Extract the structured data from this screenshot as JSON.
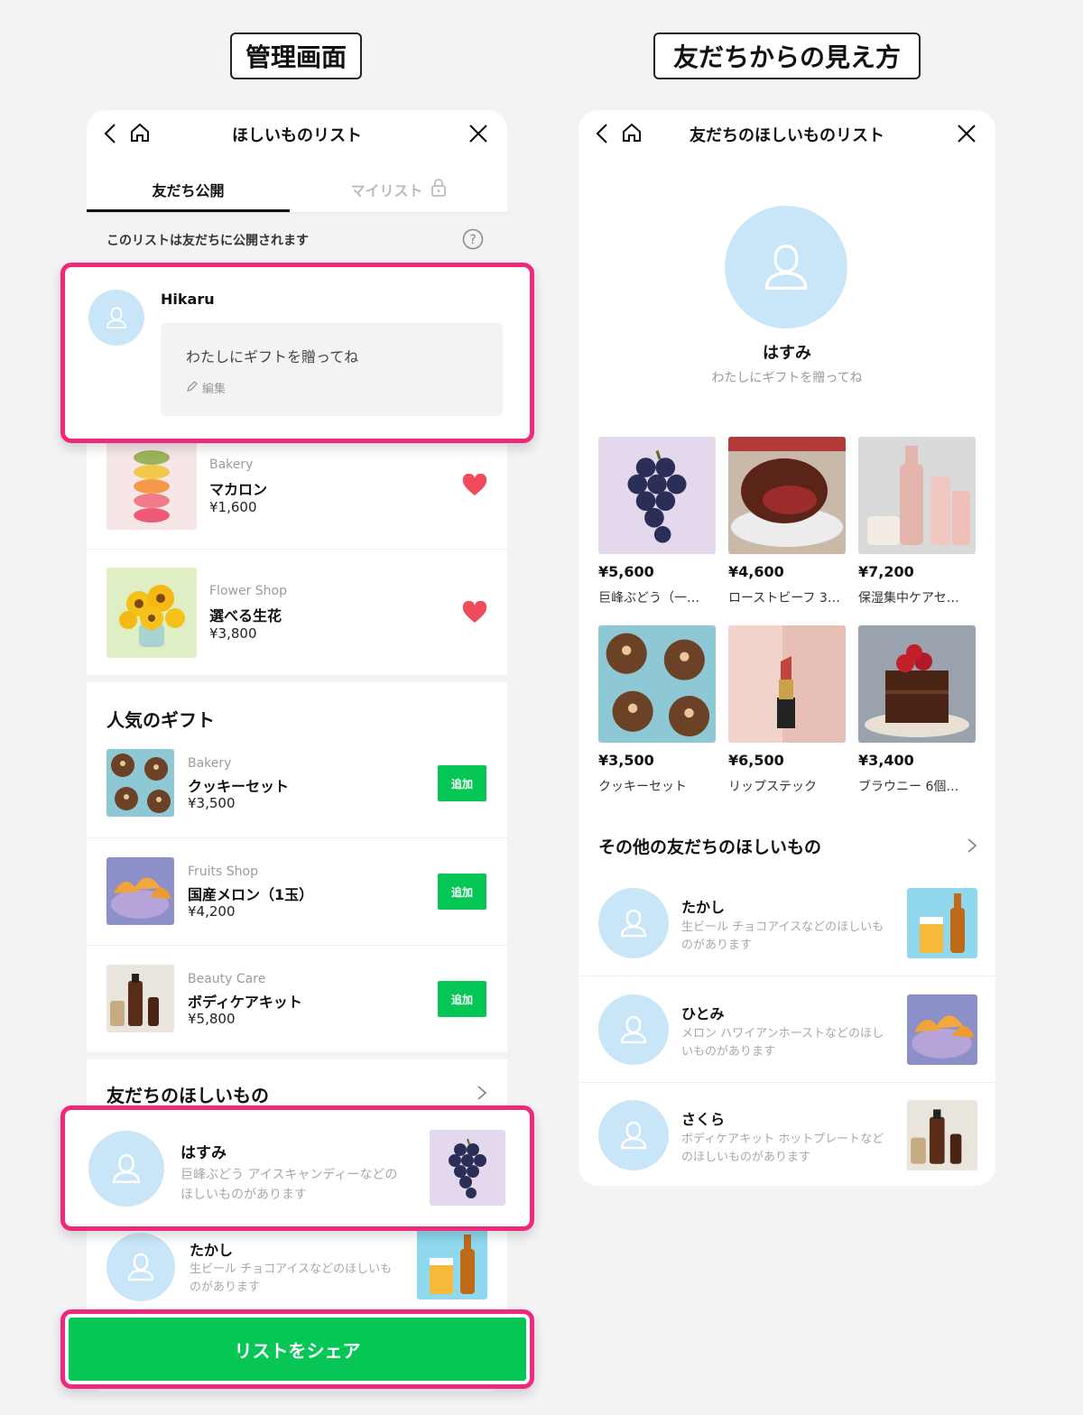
{
  "labels": {
    "admin": "管理画面",
    "friend_view": "友だちからの見え方"
  },
  "admin": {
    "title": "ほしいものリスト",
    "tabs": [
      {
        "label": "友だち公開",
        "active": true
      },
      {
        "label": "マイリスト",
        "active": false
      }
    ],
    "notice": "このリストは友だちに公開されます",
    "profile": {
      "name": "Hikaru",
      "message": "わたしにギフトを贈ってね",
      "edit_label": "編集"
    },
    "wishlist": [
      {
        "category": "Bakery",
        "name": "マカロン",
        "price": "¥1,600"
      },
      {
        "category": "Flower Shop",
        "name": "選べる生花",
        "price": "¥3,800"
      }
    ],
    "popular_title": "人気のギフト",
    "popular": [
      {
        "category": "Bakery",
        "name": "クッキーセット",
        "price": "¥3,500",
        "button": "追加"
      },
      {
        "category": "Fruits Shop",
        "name": "国産メロン（1玉）",
        "price": "¥4,200",
        "button": "追加"
      },
      {
        "category": "Beauty Care",
        "name": "ボディケアキット",
        "price": "¥5,800",
        "button": "追加"
      }
    ],
    "friends_title": "友だちのほしいもの",
    "friends": [
      {
        "name": "はすみ",
        "message_line1": "巨峰ぶどう アイスキャンディーなどの",
        "message_line2": "ほしいものがあります"
      },
      {
        "name": "たかし",
        "message_line1": "生ビール チョコアイスなどのほしいも",
        "message_line2": "のがあります"
      }
    ],
    "share_button": "リストをシェア"
  },
  "friend_view": {
    "title": "友だちのほしいものリスト",
    "profile": {
      "name": "はすみ",
      "message": "わたしにギフトを贈ってね"
    },
    "items": [
      {
        "price": "¥5,600",
        "name": "巨峰ぶどう（一…"
      },
      {
        "price": "¥4,600",
        "name": "ローストビーフ 3…"
      },
      {
        "price": "¥7,200",
        "name": "保湿集中ケアセ…"
      },
      {
        "price": "¥3,500",
        "name": "クッキーセット"
      },
      {
        "price": "¥6,500",
        "name": "リップステック"
      },
      {
        "price": "¥3,400",
        "name": "ブラウニー 6個…"
      }
    ],
    "others_title": "その他の友だちのほしいもの",
    "others": [
      {
        "name": "たかし",
        "message_line1": "生ビール チョコアイスなどのほしいも",
        "message_line2": "のがあります"
      },
      {
        "name": "ひとみ",
        "message_line1": "メロン ハワイアンホーストなどのほし",
        "message_line2": "いものがあります"
      },
      {
        "name": "さくら",
        "message_line1": "ボディケアキット ホットプレートなど",
        "message_line2": "のほしいものがあります"
      }
    ]
  },
  "colors": {
    "line_green": "#06c755",
    "highlight_pink": "#f0287c",
    "heart_red": "#f04a5d",
    "avatar_blue": "#c8e6f7"
  }
}
